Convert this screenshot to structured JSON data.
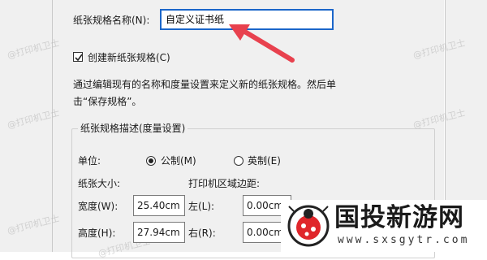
{
  "form": {
    "paper_name_label": "纸张规格名称(N):",
    "paper_name_value": "自定义证书纸",
    "create_new_label": "创建新纸张规格(C)",
    "create_new_checked": true,
    "help_line1": "通过编辑现有的名称和度量设置来定义新的纸张规格。然后单",
    "help_line2": "击“保存规格”。",
    "group_title": "纸张规格描述(度量设置)",
    "units_label": "单位:",
    "unit_metric": "公制(M)",
    "unit_imperial": "英制(E)",
    "selected_unit": "公制(M)",
    "paper_size_label": "纸张大小:",
    "printer_margin_label": "打印机区域边距:",
    "width_label": "宽度(W):",
    "width_value": "25.40cm",
    "height_label": "高度(H):",
    "height_value": "27.94cm",
    "left_label": "左(L):",
    "left_value": "0.00cm",
    "right_label": "右(R):",
    "right_value": "0.00cm"
  },
  "annotation": {
    "arrow_color": "#e8414e"
  },
  "watermark": {
    "text": "@打印机卫士"
  },
  "brand": {
    "name": "国投新游网",
    "url": "www.sxsgytr.com",
    "accent_red": "#e0262b"
  }
}
